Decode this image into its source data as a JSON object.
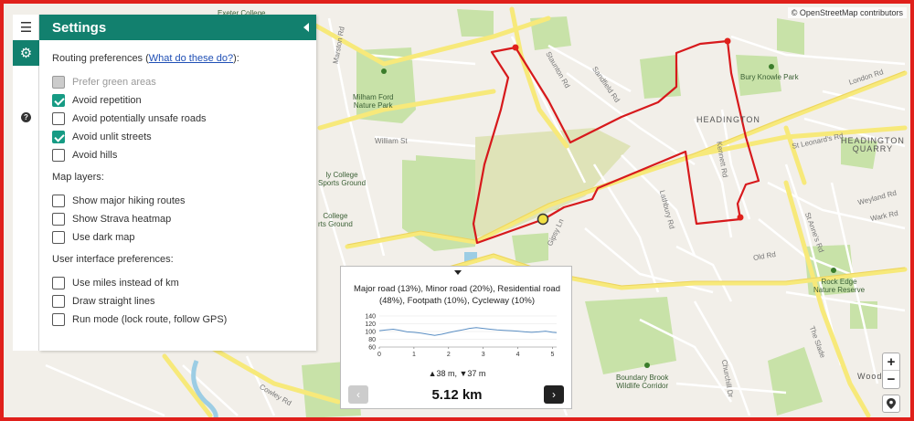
{
  "map": {
    "attribution": "© OpenStreetMap contributors",
    "labels": {
      "exeter_college": "Exeter College",
      "milham_ford": "Milham Ford\nNature Park",
      "william_st": "William St",
      "slaymon_rd": "Staunton Rd",
      "sandfield_rd": "Sandfield Rd",
      "headington": "HEADINGTON",
      "headington_quarry": "HEADINGTON\nQUARRY",
      "bury_knowle": "Bury Knowle Park",
      "london_rd": "London Rd",
      "kennett_rd": "Kennett Rd",
      "lathbury_rd": "Lathbury Rd",
      "wood_farm": "Wood",
      "rock_edge": "Rock Edge\nNature Reserve",
      "boundary_brook": "Boundary Brook\nWildlife Corridor",
      "college_sports": "ly College\nSports Ground",
      "college_sports2": "College\nrts Ground",
      "weyland_rd": "Weyland Rd",
      "wark_rd": "Wark Rd",
      "st_annes": "St Anne's Rd",
      "st_leonards": "St Leonard's Rd",
      "gipsy_ln": "Gipsy Ln",
      "cowley_rd": "Cowley Rd",
      "the_slade": "The Slade",
      "churchill": "Churchill Dr",
      "marston_rd": "Marston Rd",
      "old_road": "Old Rd"
    },
    "colors": {
      "route": "#d7191c",
      "marker": "#e0201b",
      "current_marker": "#f1e045",
      "park": "#c8e2a8",
      "road_major": "#f7e97a",
      "road_minor": "#ffffff",
      "water": "#9ccde4"
    }
  },
  "sidebar": {
    "menu_icon": "hamburger-icon",
    "settings_icon": "gear-icon",
    "help_icon": "question-icon"
  },
  "settings": {
    "title": "Settings",
    "routing_title": "Routing preferences (",
    "routing_link": "What do these do?",
    "routing_suffix": "):",
    "routing_options": [
      {
        "label": "Prefer green areas",
        "checked": false,
        "disabled": true
      },
      {
        "label": "Avoid repetition",
        "checked": true,
        "disabled": false
      },
      {
        "label": "Avoid potentially unsafe roads",
        "checked": false,
        "disabled": false
      },
      {
        "label": "Avoid unlit streets",
        "checked": true,
        "disabled": false
      },
      {
        "label": "Avoid hills",
        "checked": false,
        "disabled": false
      }
    ],
    "layers_title": "Map layers:",
    "layer_options": [
      {
        "label": "Show major hiking routes",
        "checked": false
      },
      {
        "label": "Show Strava heatmap",
        "checked": false
      },
      {
        "label": "Use dark map",
        "checked": false
      }
    ],
    "ui_title": "User interface preferences:",
    "ui_options": [
      {
        "label": "Use miles instead of km",
        "checked": false
      },
      {
        "label": "Draw straight lines",
        "checked": false
      },
      {
        "label": "Run mode (lock route, follow GPS)",
        "checked": false
      }
    ]
  },
  "zoom": {
    "plus": "+",
    "minus": "−"
  },
  "route": {
    "summary": "Major road (13%), Minor road (20%), Residential road (48%), Footpath (10%), Cycleway (10%)",
    "elevation": {
      "y_ticks": [
        140,
        120,
        100,
        80,
        60
      ],
      "x_ticks": [
        0,
        1,
        2,
        3,
        4,
        5
      ],
      "profile": [
        [
          0,
          102
        ],
        [
          0.2,
          104
        ],
        [
          0.4,
          106
        ],
        [
          0.6,
          103
        ],
        [
          0.8,
          99
        ],
        [
          1.0,
          98
        ],
        [
          1.2,
          96
        ],
        [
          1.4,
          93
        ],
        [
          1.6,
          90
        ],
        [
          1.8,
          93
        ],
        [
          2.0,
          97
        ],
        [
          2.2,
          101
        ],
        [
          2.4,
          104
        ],
        [
          2.6,
          108
        ],
        [
          2.8,
          110
        ],
        [
          3.0,
          108
        ],
        [
          3.2,
          106
        ],
        [
          3.4,
          104
        ],
        [
          3.6,
          103
        ],
        [
          3.8,
          102
        ],
        [
          4.0,
          101
        ],
        [
          4.2,
          99
        ],
        [
          4.4,
          98
        ],
        [
          4.6,
          99
        ],
        [
          4.8,
          101
        ],
        [
          5.0,
          98
        ],
        [
          5.12,
          97
        ]
      ],
      "ylim": [
        60,
        140
      ],
      "xlim": [
        0,
        5.12
      ]
    },
    "elevation_gain": "▲38 m, ▼37 m",
    "distance": "5.12 km",
    "prev_label": "‹",
    "next_label": "›"
  }
}
